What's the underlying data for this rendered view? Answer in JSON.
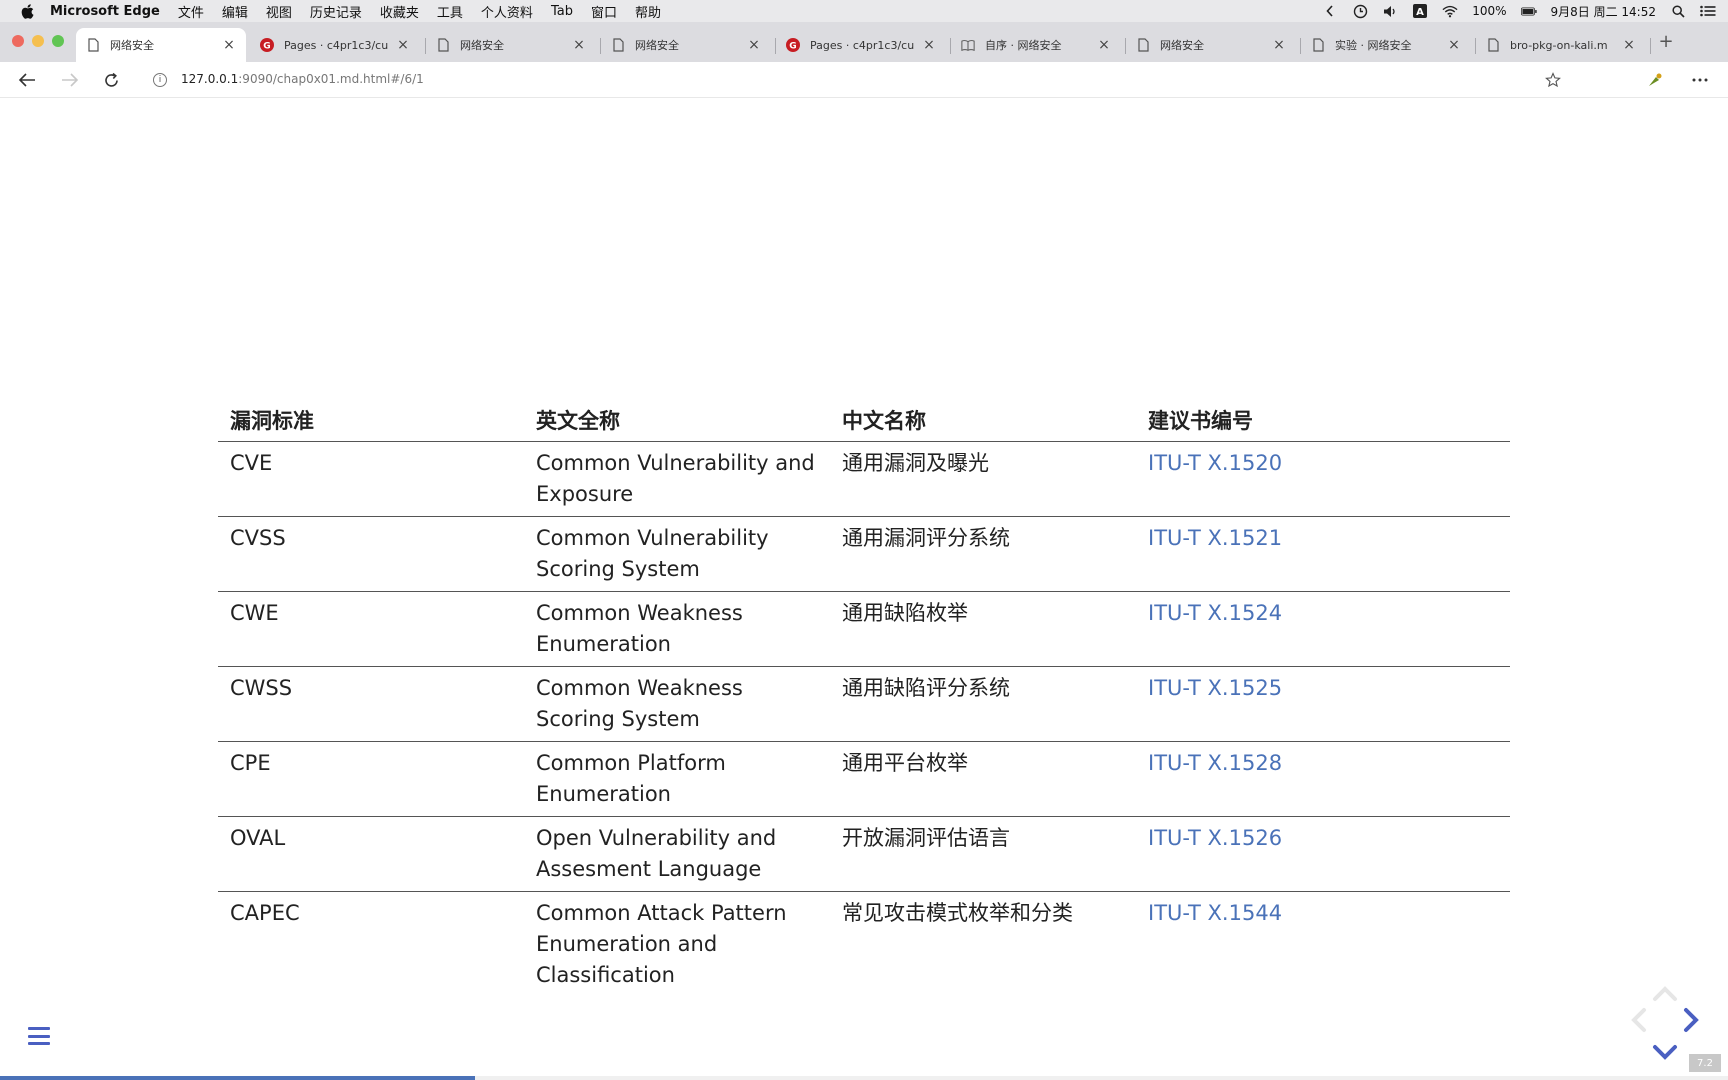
{
  "menubar": {
    "app_name": "Microsoft Edge",
    "items": [
      "文件",
      "编辑",
      "视图",
      "历史记录",
      "收藏夹",
      "工具",
      "个人资料",
      "Tab",
      "窗口",
      "帮助"
    ],
    "battery": "100%",
    "datetime": "9月8日 周二  14:52"
  },
  "tabs": [
    {
      "title": "网络安全",
      "icon": "page-icon"
    },
    {
      "title": "Pages · c4pr1c3/cu",
      "icon": "gitee-icon"
    },
    {
      "title": "网络安全",
      "icon": "page-icon"
    },
    {
      "title": "网络安全",
      "icon": "page-icon"
    },
    {
      "title": "Pages · c4pr1c3/cu",
      "icon": "gitee-icon"
    },
    {
      "title": "自序 · 网络安全",
      "icon": "book-icon"
    },
    {
      "title": "网络安全",
      "icon": "page-icon"
    },
    {
      "title": "实验 · 网络安全",
      "icon": "page-icon"
    },
    {
      "title": "bro-pkg-on-kali.m",
      "icon": "page-icon"
    }
  ],
  "toolbar": {
    "url_host": "127.0.0.1",
    "url_rest": ":9090/chap0x01.md.html#/6/1"
  },
  "table": {
    "headers": [
      "漏洞标准",
      "英文全称",
      "中文名称",
      "建议书编号"
    ],
    "rows": [
      {
        "abbr": "CVE",
        "english": "Common Vulnerability and Exposure",
        "chinese": "通用漏洞及曝光",
        "itu": "ITU-T X.1520"
      },
      {
        "abbr": "CVSS",
        "english": "Common Vulnerability Scoring System",
        "chinese": "通用漏洞评分系统",
        "itu": "ITU-T X.1521"
      },
      {
        "abbr": "CWE",
        "english": "Common Weakness Enumeration",
        "chinese": "通用缺陷枚举",
        "itu": "ITU-T X.1524"
      },
      {
        "abbr": "CWSS",
        "english": "Common Weakness Scoring System",
        "chinese": "通用缺陷评分系统",
        "itu": "ITU-T X.1525"
      },
      {
        "abbr": "CPE",
        "english": "Common Platform Enumeration",
        "chinese": "通用平台枚举",
        "itu": "ITU-T X.1528"
      },
      {
        "abbr": "OVAL",
        "english": "Open Vulnerability and Assesment Language",
        "chinese": "开放漏洞评估语言",
        "itu": "ITU-T X.1526"
      },
      {
        "abbr": "CAPEC",
        "english": "Common Attack Pattern Enumeration and Classification",
        "chinese": "常见攻击模式枚举和分类",
        "itu": "ITU-T X.1544"
      }
    ]
  },
  "slide_number": "7.2",
  "progress": 0.275,
  "colors": {
    "link": "#4a72b8",
    "reveal_accent": "#4a5fc1"
  }
}
